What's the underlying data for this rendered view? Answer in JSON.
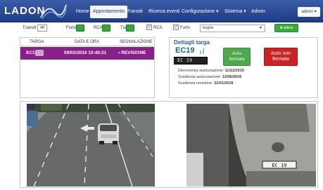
{
  "app": {
    "brand": "LADON"
  },
  "nav": {
    "items": [
      {
        "label": "Home"
      },
      {
        "label": "Appostamento"
      },
      {
        "label": "Transiti"
      },
      {
        "label": "Ricerca eventi"
      },
      {
        "label": "Configurazione ▾"
      },
      {
        "label": "Sistema ▾"
      },
      {
        "label": "Admin"
      }
    ],
    "active_index": 1,
    "user_label": "admin ▾"
  },
  "filters": {
    "transiti_label": "Transiti",
    "transiti_value": "48",
    "furto_label": "Furto",
    "rca_label": "RCA",
    "tiu_label": "Tiu",
    "check_rca_label": "RCA",
    "check_rca_checked": true,
    "check_furto_label": "Furto",
    "check_furto_checked": true,
    "select_value": "targhe",
    "apply_label": "■ attiva",
    "colors": {
      "green": "#36a83a"
    }
  },
  "events_table": {
    "columns": [
      "TARGA",
      "DATA E ORA",
      "SEGNALAZIONE"
    ],
    "rows": [
      {
        "targa": "EC19",
        "data_ora": "09/02/2016 10:40:21",
        "segnalazione": "• REVISIONE"
      }
    ],
    "row_color": "#8a1e8a"
  },
  "detail": {
    "title": "Dettagli targa",
    "plate": "EC19",
    "plate_image_text": "EC 19",
    "btn_ok_line1": "Auto",
    "btn_ok_line2": "fermata",
    "btn_ko_line1": "Auto non",
    "btn_ko_line2": "fermata",
    "info": [
      {
        "label": "Decorrenza assicurazione:",
        "value": "11/12/2015"
      },
      {
        "label": "Scadenza assicurazione:",
        "value": "12/06/2016"
      },
      {
        "label": "Scadenza revisione:",
        "value": "31/01/2016"
      }
    ],
    "colors": {
      "ok": "#4ea84e",
      "ko": "#cc2222",
      "title": "#1f5fa8"
    }
  },
  "images": {
    "rear_plate_text": "EC 19"
  }
}
